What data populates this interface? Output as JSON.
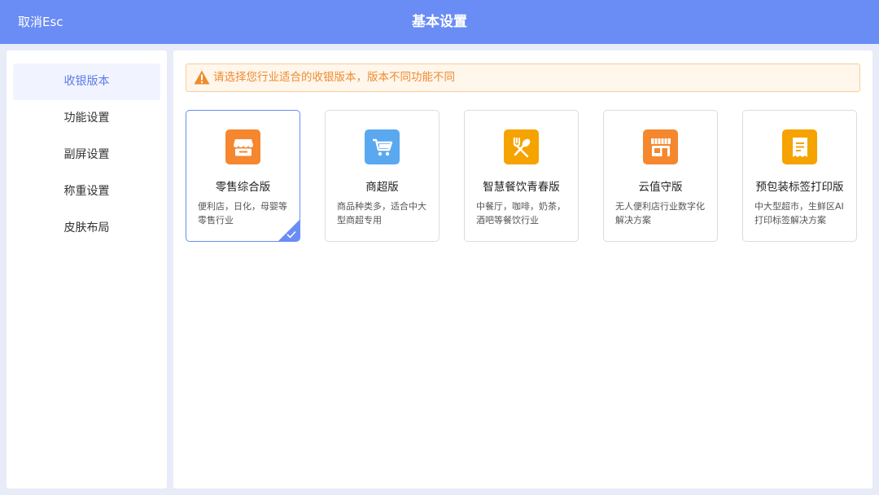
{
  "header": {
    "cancel_label": "取消Esc",
    "title": "基本设置"
  },
  "sidebar": {
    "items": [
      {
        "label": "收银版本",
        "active": true
      },
      {
        "label": "功能设置"
      },
      {
        "label": "副屏设置"
      },
      {
        "label": "称重设置"
      },
      {
        "label": "皮肤布局"
      }
    ]
  },
  "notice": {
    "text": "请选择您行业适合的收银版本，版本不同功能不同",
    "icon": "warning-icon"
  },
  "cards": [
    {
      "name": "零售综合版",
      "desc": "便利店，日化，母婴等零售行业",
      "icon": "store-icon",
      "color": "#f5872f",
      "selected": true
    },
    {
      "name": "商超版",
      "desc": "商品种类多，适合中大型商超专用",
      "icon": "cart-icon",
      "color": "#5aa8f0"
    },
    {
      "name": "智慧餐饮青春版",
      "desc": "中餐厅，咖啡，奶茶，酒吧等餐饮行业",
      "icon": "utensils-icon",
      "color": "#f5a300"
    },
    {
      "name": "云值守版",
      "desc": "无人便利店行业数字化解决方案",
      "icon": "shop-front-icon",
      "color": "#f5872f"
    },
    {
      "name": "预包装标签打印版",
      "desc": "中大型超市，生鲜区AI打印标签解决方案",
      "icon": "receipt-icon",
      "color": "#f5a300"
    }
  ],
  "colors": {
    "header_bg": "#6a8cf5",
    "accent": "#5b7be8",
    "notice_text": "#ee8c2e"
  }
}
